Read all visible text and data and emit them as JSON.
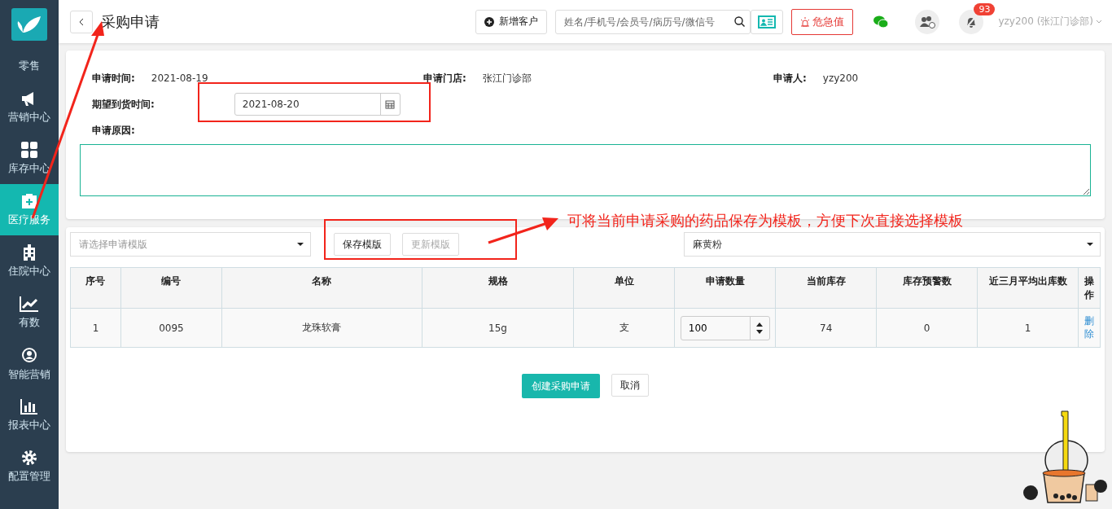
{
  "sidebar": {
    "items": [
      {
        "label": "零售",
        "selected": false
      },
      {
        "label": "营销中心",
        "selected": false
      },
      {
        "label": "库存中心",
        "selected": false
      },
      {
        "label": "医疗服务",
        "selected": true
      },
      {
        "label": "住院中心",
        "selected": false
      },
      {
        "label": "有数",
        "selected": false
      },
      {
        "label": "智能营销",
        "selected": false
      },
      {
        "label": "报表中心",
        "selected": false
      },
      {
        "label": "配置管理",
        "selected": false
      }
    ]
  },
  "header": {
    "title": "采购申请",
    "new_customer": "新增客户",
    "search": {
      "placeholder": "姓名/手机号/会员号/病历号/微信号"
    },
    "critical": "危急值",
    "notification_count": "93",
    "user": "yzy200 (张江门诊部)"
  },
  "form": {
    "info": [
      {
        "label": "申请时间:",
        "value": "2021-08-19"
      },
      {
        "label": "申请门店:",
        "value": "张江门诊部"
      },
      {
        "label": "申请人:",
        "value": "yzy200"
      }
    ],
    "expected_date": {
      "label": "期望到货时间:",
      "value": "2021-08-20"
    },
    "reason": {
      "label": "申请原因:",
      "focused": true
    }
  },
  "items": {
    "template_select": {
      "placeholder": "请选择申请模版"
    },
    "buttons": [
      {
        "label": "保存模版",
        "disabled": false
      },
      {
        "label": "更新模版",
        "disabled": true
      }
    ],
    "product_select": {
      "value": "麻黄粉"
    },
    "table": {
      "columns": [
        "序号",
        "编号",
        "名称",
        "规格",
        "单位",
        "申请数量",
        "当前库存",
        "库存预警数",
        "近三月平均出库数",
        "操作"
      ],
      "rows": [
        {
          "index": "1",
          "code": "0095",
          "name": "龙珠软膏",
          "spec": "15g",
          "unit": "支",
          "quantity": "100",
          "stock": "74",
          "warning": "0",
          "avg_out": "1",
          "action": "删除"
        }
      ]
    },
    "create": "创建采购申请",
    "cancel": "取消"
  },
  "annotation": {
    "text": "可将当前申请采购的药品保存为模板，方便下次直接选择模板"
  }
}
